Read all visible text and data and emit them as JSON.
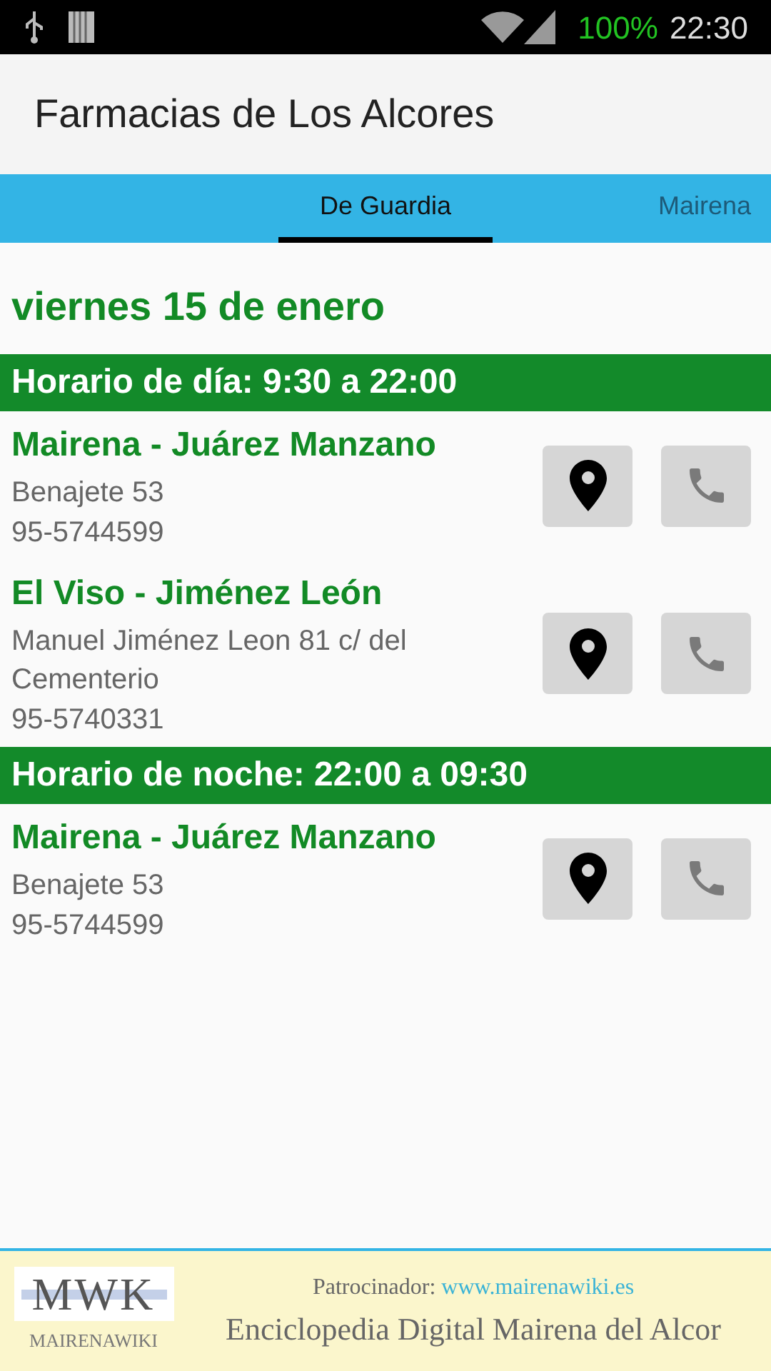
{
  "status_bar": {
    "battery": "100%",
    "time": "22:30"
  },
  "app_bar": {
    "title": "Farmacias de Los Alcores"
  },
  "tabs": [
    {
      "label": "De Guardia",
      "selected": true
    },
    {
      "label": "Mairena",
      "selected": false
    }
  ],
  "date": "viernes 15 de enero",
  "sections": [
    {
      "heading": "Horario de día: 9:30 a 22:00",
      "pharmacies": [
        {
          "name": "Mairena - Juárez Manzano",
          "address": "Benajete 53",
          "phone": "95-5744599"
        },
        {
          "name": "El Viso - Jiménez León",
          "address": "Manuel Jiménez Leon 81 c/ del Cementerio",
          "phone": "95-5740331"
        }
      ]
    },
    {
      "heading": "Horario de noche: 22:00 a 09:30",
      "pharmacies": [
        {
          "name": "Mairena - Juárez Manzano",
          "address": "Benajete 53",
          "phone": "95-5744599"
        }
      ]
    }
  ],
  "banner": {
    "logo": "MWK",
    "logo_caption": "MAIRENAWIKI",
    "sponsor_label": "Patrocinador:",
    "sponsor_link": "www.mairenawiki.es",
    "tagline": "Enciclopedia Digital Mairena del Alcor"
  }
}
